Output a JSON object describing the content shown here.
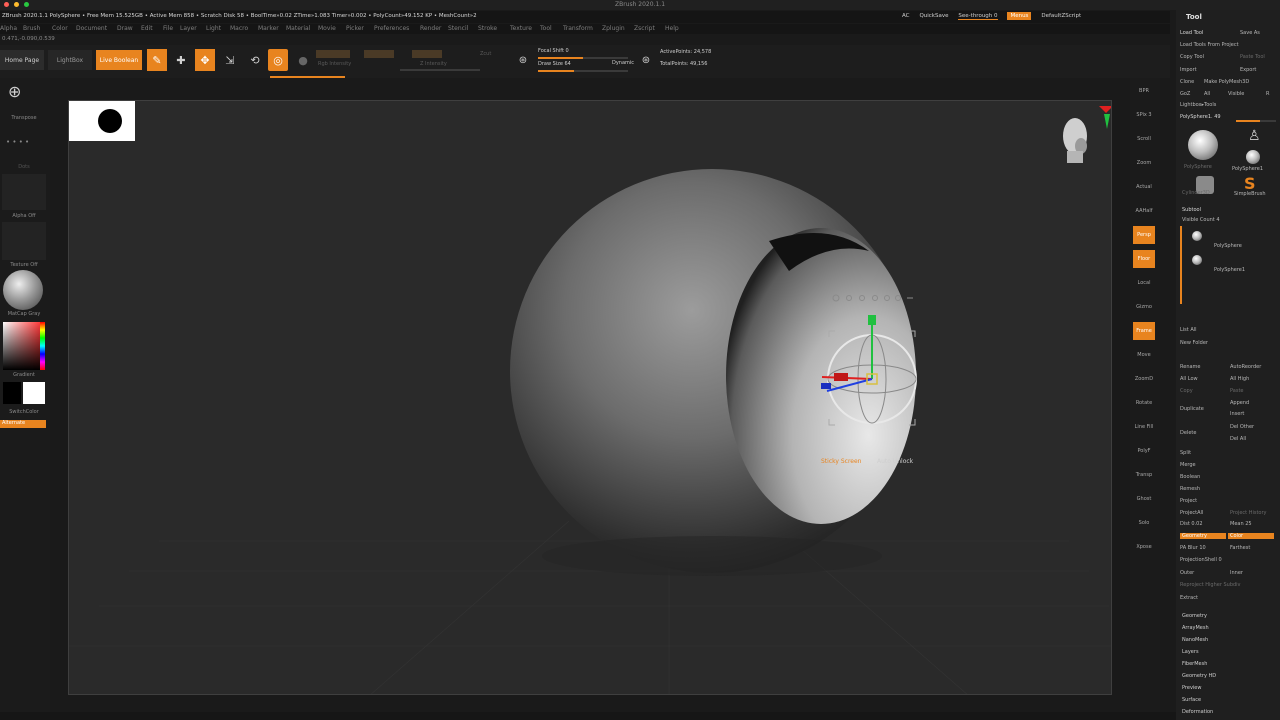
{
  "app": {
    "title": "ZBrush 2020.1.1",
    "window_dots": [
      "#ff5f57",
      "#febc2e",
      "#28c840"
    ]
  },
  "infobar": {
    "stats": "ZBrush 2020.1.1 PolySphere   • Free Mem 15.525GB • Active Mem 858 • Scratch Disk 58 • BoolTime»0.02 ZTime»1.083 Timer»0.002 • PolyCount»49.152 KP • MeshCount»2",
    "ac": "AC",
    "quicksave": "QuickSave",
    "see_through": "See-through 0",
    "menus_chip": "Menus",
    "default_zscript": "DefaultZScript"
  },
  "menubar": [
    "Alpha",
    "Brush",
    "Color",
    "Document",
    "Draw",
    "Edit",
    "File",
    "Layer",
    "Light",
    "Macro",
    "Marker",
    "Material",
    "Movie",
    "Picker",
    "Preferences",
    "Render",
    "Stencil",
    "Stroke",
    "Texture",
    "Tool",
    "Transform",
    "Zplugin",
    "Zscript",
    "Help"
  ],
  "coords": "0.471,-0.090,0.539",
  "toolbar": {
    "home_page": "Home Page",
    "lightbox": "LightBox",
    "live_boolean": "Live Boolean",
    "edit": "Edit",
    "draw": "Draw",
    "move": "Move",
    "scale": "Scale",
    "rotate": "Rotate",
    "mrgb": "Mrgb",
    "rgb": "Rgb",
    "m": "M",
    "zadd": "Zadd",
    "zsub": "Zsub",
    "zcut": "Zcut",
    "rgb_intensity": "Rgb Intensity",
    "z_intensity": "Z Intensity",
    "focal_shift": "Focal Shift 0",
    "draw_size": "Draw Size 64",
    "dynamic": "Dynamic",
    "active_points": "ActivePoints: 24,578",
    "total_points": "TotalPoints: 49,156",
    "focal_shift_fraction": 0.5,
    "draw_size_fraction": 0.4
  },
  "leftshelf": {
    "transpose": "Transpose",
    "dots": "Dots",
    "alpha_off": "Alpha Off",
    "texture_off": "Texture Off",
    "matcap": "MatCap Gray",
    "gradient": "Gradient",
    "switch_color": "SwitchColor",
    "alternate": "Alternate"
  },
  "viewport": {
    "gizmo_label_a": "Sticky Screen",
    "gizmo_label_b": "Auto Unlock"
  },
  "rightshelf": [
    "BPR",
    "SPix 3",
    "Scroll",
    "Zoom",
    "Actual",
    "AAHalf",
    "Persp",
    "Floor",
    "Local",
    "Gizmo",
    "Frame",
    "Move",
    "ZoomD",
    "Rotate",
    "Line Fill",
    "PolyF",
    "Transp",
    "Ghost",
    "Solo",
    "Xpose"
  ],
  "tray": {
    "title": "Tool",
    "load_tool": "Load Tool",
    "save_as": "Save As",
    "load_from_project": "Load Tools From Project",
    "copy_tool": "Copy Tool",
    "paste_tool": "Paste Tool",
    "import": "Import",
    "export": "Export",
    "clone": "Clone",
    "make_polymesh": "Make PolyMesh3D",
    "goz": "GoZ",
    "all": "All",
    "visible": "Visible",
    "r": "R",
    "lightbox_tools": "Lightbox▸Tools",
    "current_tool": "PolySphere1. 49",
    "thumbs": [
      "PolySphere",
      "PolySphere1",
      "Cylinder3D",
      "SimpleBrush"
    ],
    "subtool": "Subtool",
    "visible_count": "Visible Count 4",
    "subtools": [
      "PolySphere",
      "PolySphere1"
    ],
    "list_all": "List All",
    "new_folder": "New Folder",
    "rename": "Rename",
    "autoreorder": "AutoReorder",
    "all_low": "All Low",
    "all_high": "All High",
    "copy": "Copy",
    "paste": "Paste",
    "duplicate": "Duplicate",
    "append": "Append",
    "insert": "Insert",
    "delete": "Delete",
    "del_other": "Del Other",
    "del_all": "Del All",
    "split": "Split",
    "merge": "Merge",
    "boolean": "Boolean",
    "remesh": "Remesh",
    "project": "Project",
    "project_all": "ProjectAll",
    "project_history": "Project History",
    "dist": "Dist 0.02",
    "mean": "Mean 25",
    "geometry": "Geometry",
    "color": "Color",
    "pa_blur": "PA Blur 10",
    "farthest": "Farthest",
    "projection_shell": "ProjectionShell 0",
    "outer": "Outer",
    "inner": "Inner",
    "reproject_higher": "Reproject Higher Subdiv",
    "extract": "Extract",
    "sections": [
      "Geometry",
      "ArrayMesh",
      "NanoMesh",
      "Layers",
      "FiberMesh",
      "Geometry HD",
      "Preview",
      "Surface",
      "Deformation"
    ]
  },
  "colors": {
    "accent": "#e8841f",
    "bg": "#1a1a1a",
    "canvas": "#2a2a2a"
  }
}
